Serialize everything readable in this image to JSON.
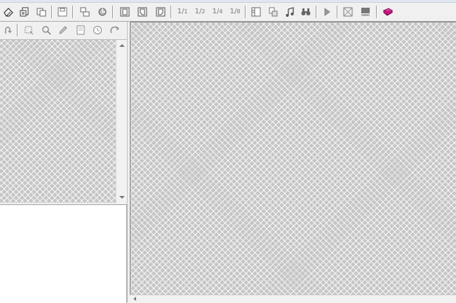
{
  "toolbar": {
    "items": [
      {
        "name": "eraser-icon"
      },
      {
        "name": "open-document-icon"
      },
      {
        "name": "copy-document-icon"
      },
      {
        "name": "save-document-icon"
      },
      {
        "name": "arrange-windows-icon"
      },
      {
        "name": "refresh-icon"
      },
      {
        "name": "document-frame-icon"
      },
      {
        "name": "document-crop-icon"
      },
      {
        "name": "document-fit-icon"
      },
      {
        "name": "zoom-1-1-icon",
        "num": "1",
        "den": "1"
      },
      {
        "name": "zoom-1-2-icon",
        "num": "1",
        "den": "2"
      },
      {
        "name": "zoom-1-4-icon",
        "num": "1",
        "den": "4"
      },
      {
        "name": "zoom-1-8-icon",
        "num": "1",
        "den": "8"
      },
      {
        "name": "panel-icon"
      },
      {
        "name": "print-icon"
      },
      {
        "name": "music-note-icon"
      },
      {
        "name": "binoculars-icon"
      },
      {
        "name": "play-icon"
      },
      {
        "name": "fit-window-icon"
      },
      {
        "name": "scanner-icon"
      },
      {
        "name": "help-book-icon"
      }
    ]
  },
  "left_toolbar": {
    "items": [
      {
        "name": "undo-icon"
      },
      {
        "name": "select-rect-icon"
      },
      {
        "name": "magnifier-icon"
      },
      {
        "name": "pencil-icon"
      },
      {
        "name": "page-icon"
      },
      {
        "name": "clock-icon"
      },
      {
        "name": "redo-icon"
      }
    ]
  },
  "colors": {
    "toolbar_bg": "#f0f0f0",
    "canvas_hatch": "#c6c6c6",
    "panel_white": "#ffffff",
    "icon_gray": "#6b6b6b",
    "help_book": "#c2187a"
  }
}
